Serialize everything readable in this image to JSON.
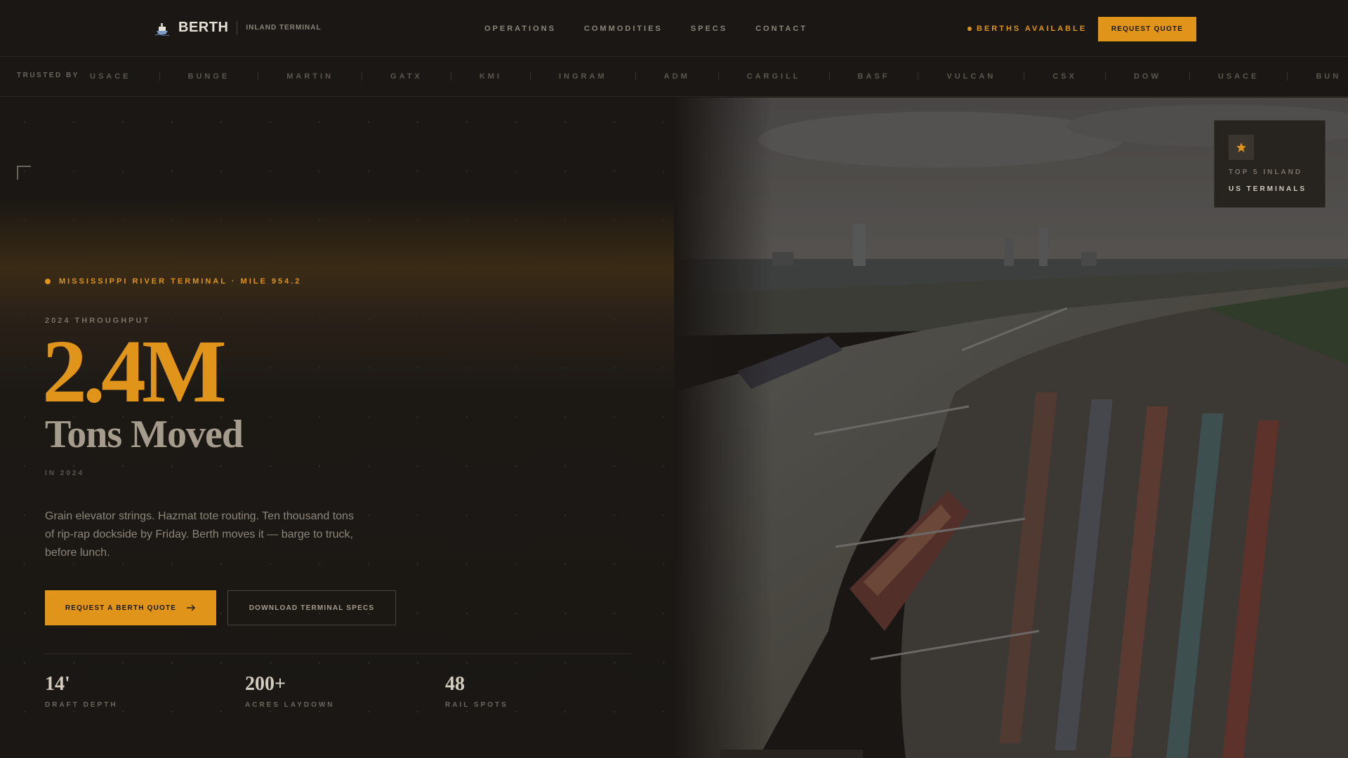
{
  "header": {
    "brand_name": "BERTH",
    "brand_sub": "INLAND TERMINAL",
    "nav": [
      "OPERATIONS",
      "COMMODITIES",
      "SPECS",
      "CONTACT"
    ],
    "status": "BERTHS AVAILABLE",
    "cta": "REQUEST QUOTE"
  },
  "trusted": {
    "label": "TRUSTED BY",
    "items": [
      "USACE",
      "BUNGE",
      "MARTIN",
      "GATX",
      "KMI",
      "INGRAM",
      "ADM",
      "CARGILL",
      "BASF",
      "VULCAN",
      "CSX",
      "DOW",
      "USACE",
      "BUN"
    ]
  },
  "hero": {
    "eyebrow": "MISSISSIPPI RIVER TERMINAL · MILE 954.2",
    "kicker": "2024 THROUGHPUT",
    "big_number": "2.4M",
    "big_sub": "Tons Moved",
    "year_note": "IN 2024",
    "description": "Grain elevator strings. Hazmat tote routing. Ten thousand tons of rip-rap dockside by Friday. Berth moves it — barge to truck, before lunch.",
    "cta_primary": "REQUEST A BERTH QUOTE",
    "cta_secondary": "DOWNLOAD TERMINAL SPECS",
    "stats": [
      {
        "value": "14'",
        "label": "DRAFT DEPTH"
      },
      {
        "value": "200+",
        "label": "ACRES LAYDOWN"
      },
      {
        "value": "48",
        "label": "RAIL SPOTS"
      }
    ]
  },
  "badge": {
    "line1": "TOP 5 INLAND",
    "line2": "US TERMINALS"
  },
  "colors": {
    "accent": "#e0941a",
    "background": "#1a1714"
  }
}
